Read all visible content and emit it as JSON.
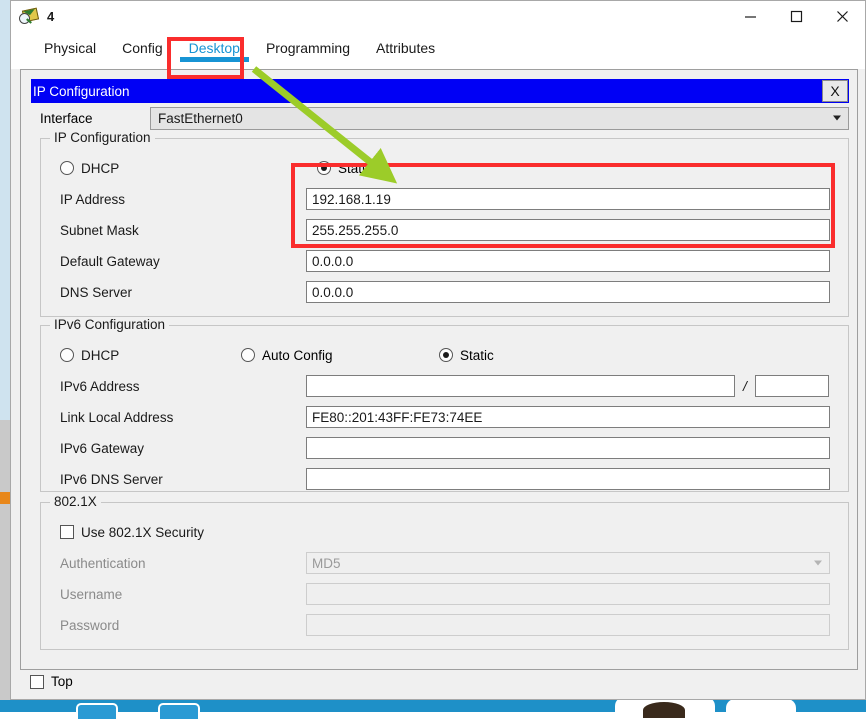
{
  "window": {
    "title": "4",
    "icon": "device-magnifier-icon",
    "controls": {
      "minimize": "minimize-icon",
      "maximize": "maximize-icon",
      "close": "close-icon"
    }
  },
  "tabs": [
    {
      "label": "Physical",
      "active": false
    },
    {
      "label": "Config",
      "active": false
    },
    {
      "label": "Desktop",
      "active": true
    },
    {
      "label": "Programming",
      "active": false
    },
    {
      "label": "Attributes",
      "active": false
    }
  ],
  "panel": {
    "title": "IP Configuration",
    "close_label": "X"
  },
  "interface": {
    "label": "Interface",
    "value": "FastEthernet0",
    "caret": "chevron-down-icon"
  },
  "ipv4": {
    "legend": "IP Configuration",
    "dhcp_label": "DHCP",
    "dhcp_selected": false,
    "static_label": "Static",
    "static_selected": true,
    "fields": [
      {
        "label": "IP Address",
        "value": "192.168.1.19",
        "disabled": false
      },
      {
        "label": "Subnet Mask",
        "value": "255.255.255.0",
        "disabled": false
      },
      {
        "label": "Default Gateway",
        "value": "0.0.0.0",
        "disabled": false
      },
      {
        "label": "DNS Server",
        "value": "0.0.0.0",
        "disabled": false
      }
    ]
  },
  "ipv6": {
    "legend": "IPv6 Configuration",
    "dhcp_label": "DHCP",
    "dhcp_selected": false,
    "autoconfig_label": "Auto Config",
    "autoconfig_selected": false,
    "static_label": "Static",
    "static_selected": true,
    "separator": "/",
    "prefix_value": "",
    "fields": [
      {
        "label": "IPv6 Address",
        "value": "",
        "disabled": false
      },
      {
        "label": "Link Local Address",
        "value": "FE80::201:43FF:FE73:74EE",
        "disabled": false
      },
      {
        "label": "IPv6 Gateway",
        "value": "",
        "disabled": false
      },
      {
        "label": "IPv6 DNS Server",
        "value": "",
        "disabled": false
      }
    ]
  },
  "dot1x": {
    "legend": "802.1X",
    "use_label": "Use 802.1X Security",
    "use_checked": false,
    "auth_label": "Authentication",
    "auth_value": "MD5",
    "username_label": "Username",
    "username_value": "",
    "password_label": "Password",
    "password_value": ""
  },
  "footer": {
    "top_label": "Top",
    "top_checked": false
  },
  "annotations": {
    "highlight_color": "#fa2d2d",
    "arrow_color": "#9ccc29",
    "arrow_from": "desktop-tab",
    "arrow_to": "ipv4-static-radio"
  },
  "colors": {
    "panel_header": "#0000f5",
    "active_tab": "#1794d4",
    "window_bg": "#f0f0f0",
    "taskbar": "#1e90c8"
  }
}
